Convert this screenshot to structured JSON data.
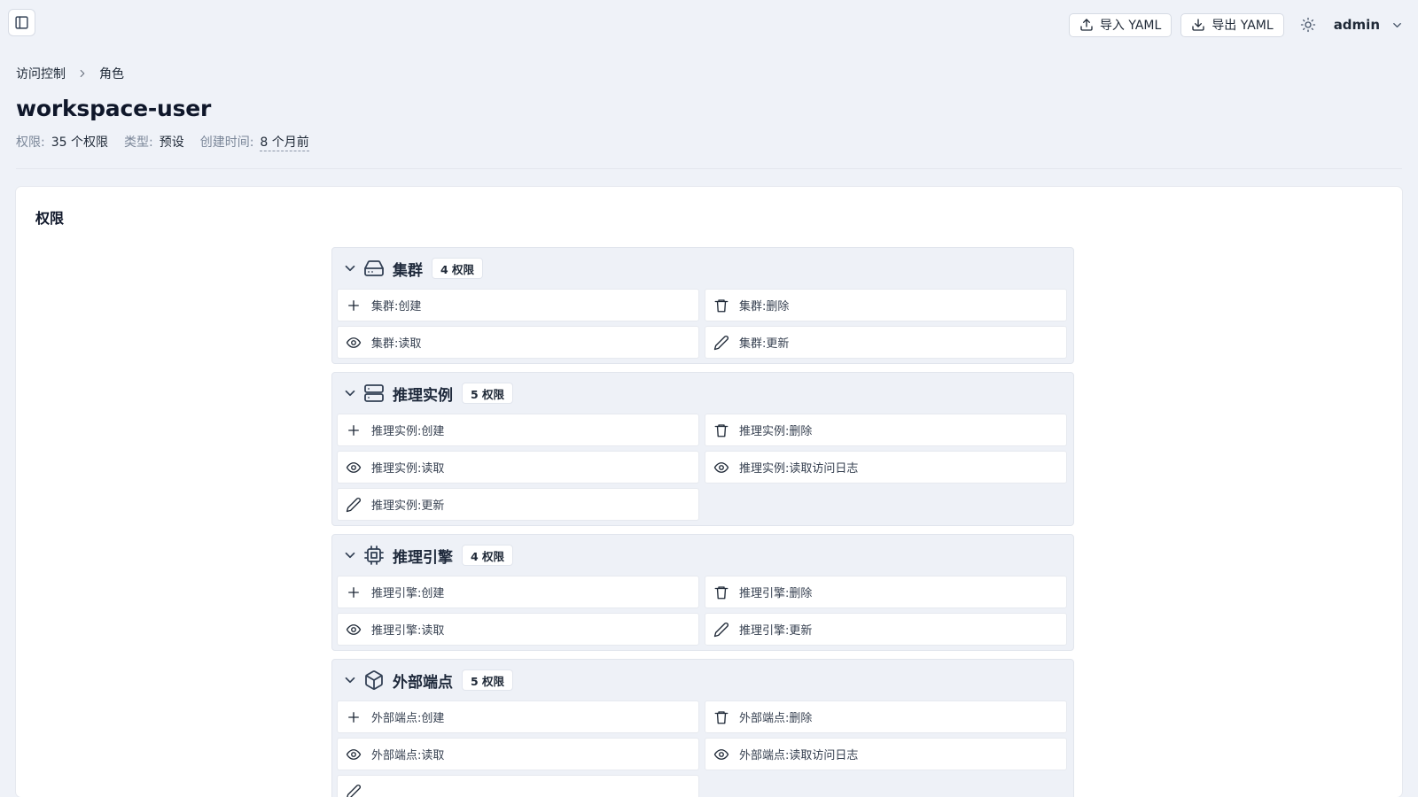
{
  "topbar": {
    "import_label": "导入 YAML",
    "export_label": "导出 YAML",
    "user": "admin"
  },
  "breadcrumb": {
    "parent": "访问控制",
    "current": "角色"
  },
  "page": {
    "title": "workspace-user",
    "meta": {
      "permissions_label": "权限:",
      "permissions_value": "35 个权限",
      "type_label": "类型:",
      "type_value": "预设",
      "created_label": "创建时间:",
      "created_value": "8 个月前"
    }
  },
  "card": {
    "title": "权限",
    "groups": [
      {
        "name": "集群",
        "count": "4 权限",
        "icon": "hard-drive-icon",
        "permissions": [
          {
            "label": "集群:创建",
            "icon": "plus-icon"
          },
          {
            "label": "集群:删除",
            "icon": "trash-icon"
          },
          {
            "label": "集群:读取",
            "icon": "eye-icon"
          },
          {
            "label": "集群:更新",
            "icon": "pencil-icon"
          }
        ]
      },
      {
        "name": "推理实例",
        "count": "5 权限",
        "icon": "server-icon",
        "permissions": [
          {
            "label": "推理实例:创建",
            "icon": "plus-icon"
          },
          {
            "label": "推理实例:删除",
            "icon": "trash-icon"
          },
          {
            "label": "推理实例:读取",
            "icon": "eye-icon"
          },
          {
            "label": "推理实例:读取访问日志",
            "icon": "eye-icon"
          },
          {
            "label": "推理实例:更新",
            "icon": "pencil-icon"
          }
        ]
      },
      {
        "name": "推理引擎",
        "count": "4 权限",
        "icon": "cpu-icon",
        "permissions": [
          {
            "label": "推理引擎:创建",
            "icon": "plus-icon"
          },
          {
            "label": "推理引擎:删除",
            "icon": "trash-icon"
          },
          {
            "label": "推理引擎:读取",
            "icon": "eye-icon"
          },
          {
            "label": "推理引擎:更新",
            "icon": "pencil-icon"
          }
        ]
      },
      {
        "name": "外部端点",
        "count": "5 权限",
        "icon": "box-icon",
        "permissions": [
          {
            "label": "外部端点:创建",
            "icon": "plus-icon"
          },
          {
            "label": "外部端点:删除",
            "icon": "trash-icon"
          },
          {
            "label": "外部端点:读取",
            "icon": "eye-icon"
          },
          {
            "label": "外部端点:读取访问日志",
            "icon": "eye-icon"
          },
          {
            "label": "",
            "icon": "pencil-icon"
          }
        ]
      }
    ]
  }
}
